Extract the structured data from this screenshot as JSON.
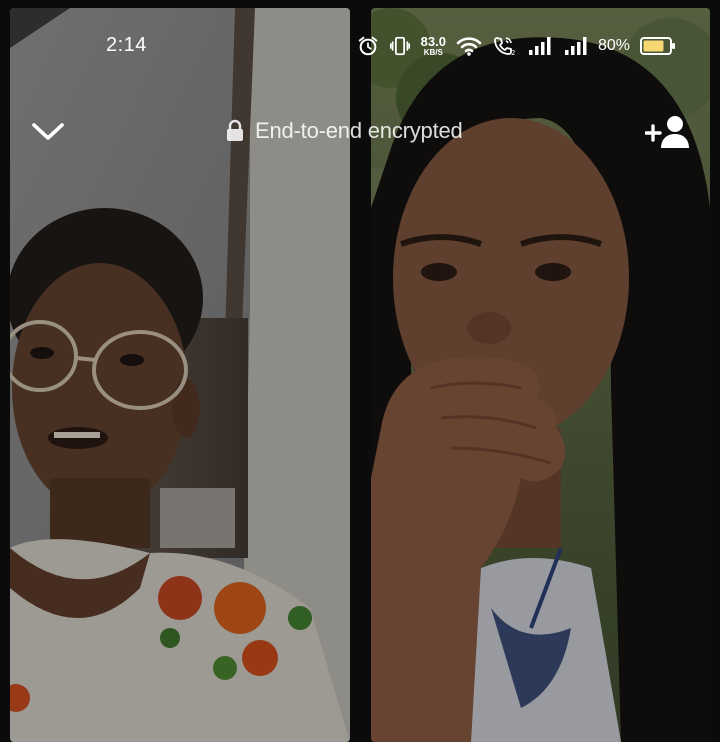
{
  "status_bar": {
    "time": "2:14",
    "network_speed_value": "83.0",
    "network_speed_unit": "KB/S",
    "battery_percent": "80%",
    "icons": [
      "alarm-icon",
      "vibrate-icon",
      "wifi-icon",
      "volte-call-icon",
      "signal-icon",
      "signal-icon",
      "battery-icon"
    ]
  },
  "call": {
    "encryption_label": "End-to-end encrypted",
    "icons": [
      "chevron-down-icon",
      "lock-icon",
      "add-person-icon"
    ]
  },
  "colors": {
    "battery_fill": "#f7d774",
    "overlay_text": "#ffffff"
  }
}
